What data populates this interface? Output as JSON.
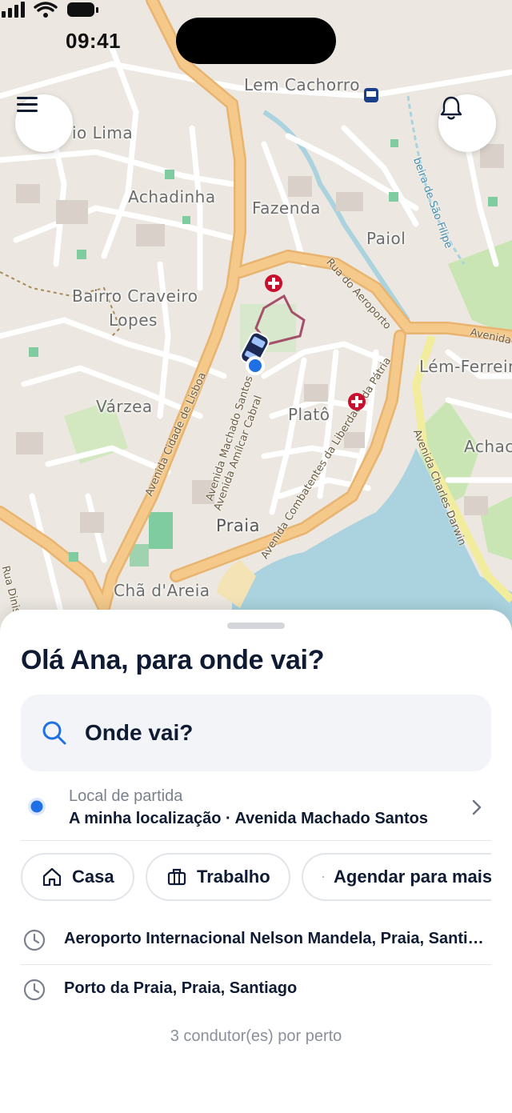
{
  "status_bar": {
    "time": "09:41"
  },
  "map": {
    "places": [
      "Lem Cachorro",
      "io Lima",
      "Achadinha",
      "Fazenda",
      "Paiol",
      "Bairro Craveiro",
      "Lopes",
      "Várzea",
      "Platô",
      "Lém-Ferreira",
      "Achac",
      "Praia",
      "Chã d'Areia"
    ],
    "roads": [
      "Rua do Aeroporto",
      "Avenida Cidade de Lisboa",
      "Avenida Machado Santos",
      "Avenida Amílcar Cabral",
      "Avenida Combatentes da Liberdade da Pátria",
      "Avenida Charles Darwin",
      "Avenida",
      "Rua Dinis",
      "beira de São Filipe"
    ]
  },
  "sheet": {
    "greeting": "Olá Ana, para onde vai?",
    "search_placeholder": "Onde vai?",
    "pickup_caption": "Local de partida",
    "pickup_value": "A minha localização · Avenida Machado Santos",
    "chips": [
      {
        "label": "Casa",
        "icon": "home-icon"
      },
      {
        "label": "Trabalho",
        "icon": "briefcase-icon"
      },
      {
        "label": "Agendar para mais tarde",
        "icon": "calendar-clock-icon"
      }
    ],
    "recent": [
      {
        "label": "Aeroporto Internacional Nelson Mandela, Praia, Santiago"
      },
      {
        "label": "Porto da Praia, Praia, Santiago"
      }
    ],
    "drivers_nearby": "3 condutor(es) por perto"
  },
  "colors": {
    "accent": "#1f6fe5",
    "primary_text": "#0f1b33",
    "hospital": "#c8102e",
    "sea": "#aad3df",
    "main_road": "#f4c98a"
  }
}
